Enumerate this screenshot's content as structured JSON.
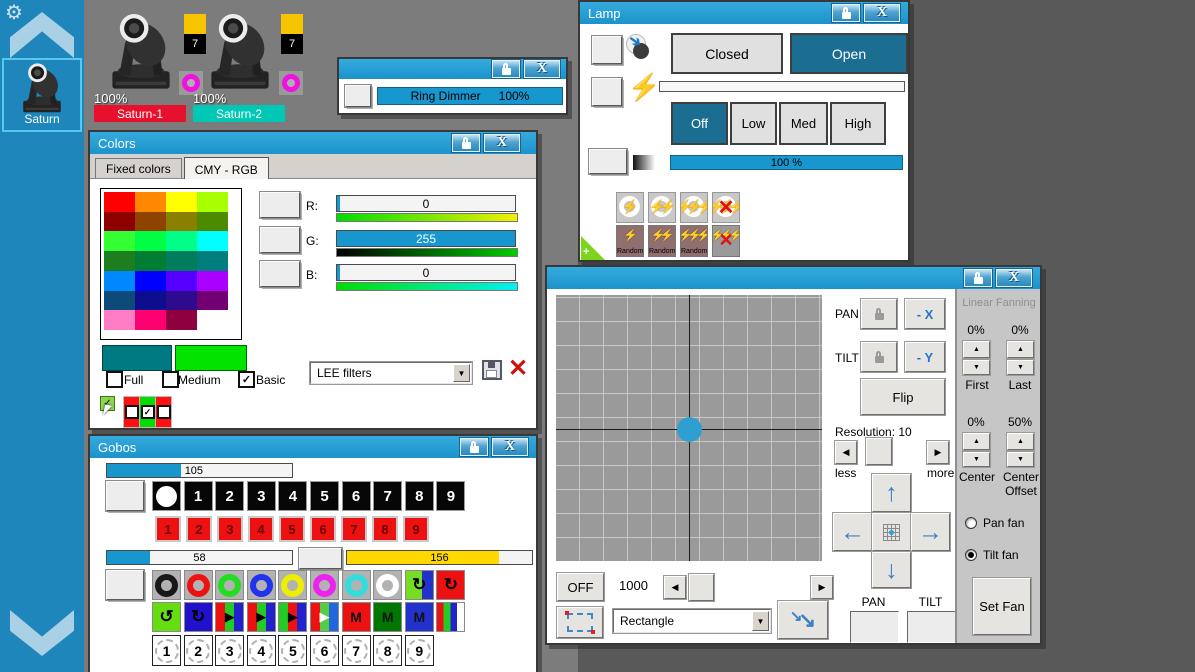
{
  "icons": {
    "close": "X",
    "gear": "⚙",
    "bolt": "⚡",
    "cross": "✕",
    "check": "✓",
    "dropdown": "▼",
    "spin_up": "▲",
    "spin_down": "▼",
    "scroll_left": "◀",
    "scroll_right": "▶",
    "rotate_cw": "↻",
    "rotate_ccw": "↺",
    "dpad_up": "↑",
    "dpad_down": "↓",
    "dpad_left": "←",
    "dpad_right": "→",
    "fan_arrow": "↘"
  },
  "theme": {
    "titlebar_blue": "#1e9ad2",
    "accent_blue": "#1896ce",
    "selected_teal": "#1b6e91",
    "sidebar_blue": "#1e86ba",
    "desktop_left": "#7c7c7c",
    "desktop_right": "#595959",
    "wheel_yellow": "#ffd800"
  },
  "sidebar": {
    "fixture_label": "Saturn"
  },
  "fixtures": [
    {
      "name": "Saturn-1",
      "intensity": "100%",
      "label_color": "#e8112d",
      "badge_color": "#f6c500",
      "badge": "7",
      "ring_color": "#f012e0"
    },
    {
      "name": "Saturn-2",
      "intensity": "100%",
      "label_color": "#00c8b4",
      "badge_color": "#f6c500",
      "badge": "7",
      "ring_color": "#f012e0"
    }
  ],
  "ring_dimmer": {
    "bar_label": "Ring Dimmer",
    "bar_value": "100%"
  },
  "colors_panel": {
    "title": "Colors",
    "tabs": [
      {
        "label": "Fixed colors",
        "active": false
      },
      {
        "label": "CMY - RGB",
        "active": true
      }
    ],
    "grid": [
      [
        "#ff0000",
        "#ff8800",
        "#ffff00",
        "#a8ff00"
      ],
      [
        "#8e0000",
        "#8e4400",
        "#8a8000",
        "#4e8a00"
      ],
      [
        "#33ff33",
        "#00ff44",
        "#00ff88",
        "#00ffff"
      ],
      [
        "#1e7d1e",
        "#007d32",
        "#007d5c",
        "#007d7d"
      ],
      [
        "#0088ff",
        "#0000ff",
        "#5500ff",
        "#aa00ff"
      ],
      [
        "#0e4a77",
        "#0d0d8e",
        "#2d0a8e",
        "#730073"
      ],
      [
        "#ff7dc4",
        "#ff0070",
        "#8e0040",
        "#ffffff"
      ]
    ],
    "sliders": [
      {
        "label": "R:",
        "value": "0",
        "filled": false,
        "grad_from": "#00dd00",
        "grad_to": "#f2f200"
      },
      {
        "label": "G:",
        "value": "255",
        "filled": true,
        "grad_from": "#000000",
        "grad_to": "#00cc00"
      },
      {
        "label": "B:",
        "value": "0",
        "filled": false,
        "grad_from": "#00dd00",
        "grad_to": "#00f2f2"
      }
    ],
    "swatches": [
      "#007a82",
      "#00e400"
    ],
    "checkboxes": [
      {
        "label": "Full",
        "checked": false
      },
      {
        "label": "Medium",
        "checked": false
      },
      {
        "label": "Basic",
        "checked": true
      }
    ],
    "filter_select": "LEE filters",
    "mini_checks": [
      {
        "bg": "#ff1111",
        "checked": false
      },
      {
        "bg": "#00dd00",
        "checked": true
      },
      {
        "bg": "#ff1111",
        "checked": false
      }
    ]
  },
  "lamp": {
    "title": "Lamp",
    "shutter_buttons": [
      {
        "label": "Closed",
        "active": false
      },
      {
        "label": "Open",
        "active": true
      }
    ],
    "strobe_buttons": [
      {
        "label": "Off",
        "active": true
      },
      {
        "label": "Low",
        "active": false
      },
      {
        "label": "Med",
        "active": false
      },
      {
        "label": "High",
        "active": false
      }
    ],
    "dimmer_value": "100 %",
    "strobe_icons": [
      {
        "bolts": 1,
        "crossed": false
      },
      {
        "bolts": 2,
        "crossed": false
      },
      {
        "bolts": 3,
        "crossed": false
      },
      {
        "bolts": 3,
        "crossed": true
      }
    ],
    "random_buttons": [
      {
        "label": "Random",
        "bolts": 1,
        "crossed": false
      },
      {
        "label": "Random",
        "bolts": 2,
        "crossed": false
      },
      {
        "label": "Random",
        "bolts": 3,
        "crossed": false
      },
      {
        "label": "",
        "bolts": 3,
        "crossed": true
      }
    ]
  },
  "gobos": {
    "title": "Gobos",
    "wheel_slider": {
      "value": "105",
      "pct": 40
    },
    "gobo_select_row": [
      "",
      "1",
      "2",
      "3",
      "4",
      "5",
      "6",
      "7",
      "8",
      "9"
    ],
    "red_row": [
      "1",
      "2",
      "3",
      "4",
      "5",
      "6",
      "7",
      "8",
      "9"
    ],
    "rotation_slider": {
      "value": "58",
      "pct": 23
    },
    "index_slider": {
      "value": "156",
      "pct": 82
    },
    "ring_row": [
      {
        "t": "ring",
        "c": "#181818"
      },
      {
        "t": "ring",
        "c": "#ee1111"
      },
      {
        "t": "ring",
        "c": "#22dd22"
      },
      {
        "t": "ring",
        "c": "#2233ee"
      },
      {
        "t": "ring",
        "c": "#eeee00"
      },
      {
        "t": "ring",
        "c": "#ee22ee"
      },
      {
        "t": "ring",
        "c": "#33dddd"
      },
      {
        "t": "ring",
        "c": "#ffffff"
      },
      {
        "t": "split",
        "stripes": [
          "#77dd22",
          "#2233cc"
        ],
        "glyph": "↻"
      },
      {
        "t": "rot",
        "bg": "#ee1111",
        "glyph": "↻"
      }
    ],
    "icon_row2": [
      {
        "t": "rot",
        "bg": "#66dd11",
        "glyph": "↺"
      },
      {
        "t": "rot",
        "bg": "#2211cc",
        "glyph": "↻"
      },
      {
        "t": "arrow",
        "stripes": [
          "#ee1111",
          "#22cc22",
          "#2222cc"
        ],
        "arrow": "#000000"
      },
      {
        "t": "arrow",
        "stripes": [
          "#ee1111",
          "#22cc22",
          "#2222cc"
        ],
        "arrow": "#000000"
      },
      {
        "t": "arrow",
        "stripes": [
          "#22cc22",
          "#ee1111",
          "#2222cc"
        ],
        "arrow": "#000000"
      },
      {
        "t": "arrow",
        "stripes": [
          "#ee1111",
          "#55cc44",
          "#2266dd"
        ],
        "arrow": "#ffffff"
      },
      {
        "t": "m",
        "bg": "#ee1111",
        "label": "M"
      },
      {
        "t": "m",
        "bg": "#007700",
        "label": "M"
      },
      {
        "t": "m",
        "bg": "#2233cc",
        "label": "M"
      },
      {
        "t": "stripes",
        "stripes": [
          "#ee1111",
          "#22cc22",
          "#2222cc",
          "#ffffff"
        ]
      }
    ],
    "shake_row": [
      "1",
      "2",
      "3",
      "4",
      "5",
      "6",
      "7",
      "8",
      "9"
    ]
  },
  "pantilt": {
    "pan": "PAN",
    "tilt": "TILT",
    "minus_x": "- X",
    "minus_y": "- Y",
    "flip": "Flip",
    "resolution": "Resolution: 10",
    "less": "less",
    "more": "more",
    "off": "OFF",
    "speed": "1000",
    "shape": "Rectangle",
    "bottom_pan": "PAN",
    "bottom_tilt": "TILT",
    "fanning": {
      "title": "Linear Fanning",
      "first_pct": "0%",
      "last_pct": "0%",
      "first": "First",
      "last": "Last",
      "center_pct": "0%",
      "offset_pct": "50%",
      "center": "Center",
      "center2": "Center",
      "offset": "Offset",
      "radios": [
        {
          "label": "Pan fan",
          "checked": false
        },
        {
          "label": "Tilt fan",
          "checked": true
        }
      ],
      "set_fan": "Set Fan"
    }
  }
}
